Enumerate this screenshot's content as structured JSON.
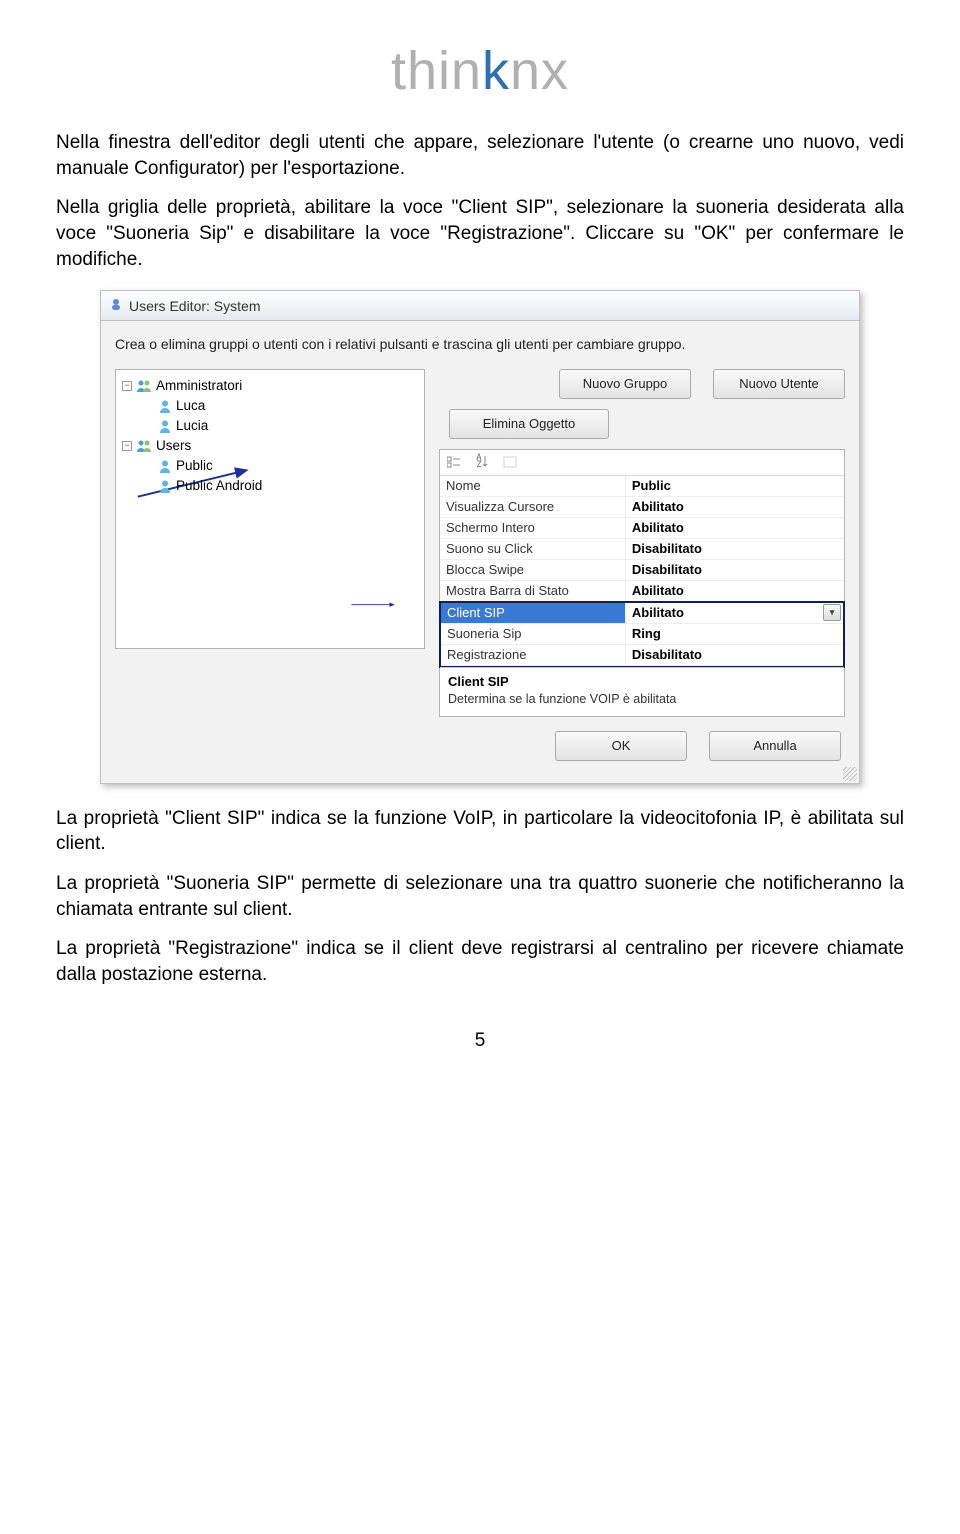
{
  "logo": {
    "part1": "thin",
    "part2": "k",
    "part3": "nx"
  },
  "paragraphs": {
    "p1": "Nella finestra dell'editor degli utenti che appare, selezionare l'utente (o crearne uno nuovo, vedi manuale Configurator) per l'esportazione.",
    "p2": "Nella griglia delle proprietà, abilitare la voce \"Client SIP\", selezionare la suoneria desiderata alla voce \"Suoneria Sip\" e disabilitare la voce \"Registrazione\". Cliccare su \"OK\" per confermare le modifiche.",
    "p3": "La proprietà \"Client SIP\" indica se la funzione VoIP, in particolare la videocitofonia IP, è abilitata sul client.",
    "p4": "La proprietà \"Suoneria SIP\" permette di selezionare una tra quattro suonerie che notificheranno la chiamata entrante sul client.",
    "p5": "La proprietà \"Registrazione\" indica se il client deve registrarsi al centralino per ricevere chiamate dalla postazione esterna."
  },
  "dialog": {
    "title": "Users Editor: System",
    "hint": "Crea o elimina gruppi o utenti con i relativi pulsanti e trascina gli utenti per cambiare gruppo.",
    "buttons": {
      "newGroup": "Nuovo Gruppo",
      "newUser": "Nuovo Utente",
      "delete": "Elimina Oggetto",
      "ok": "OK",
      "cancel": "Annulla"
    },
    "tree": [
      {
        "type": "group",
        "label": "Amministratori",
        "level": 0
      },
      {
        "type": "user",
        "label": "Luca",
        "level": 1
      },
      {
        "type": "user",
        "label": "Lucia",
        "level": 1
      },
      {
        "type": "group",
        "label": "Users",
        "level": 0
      },
      {
        "type": "user",
        "label": "Public",
        "level": 1
      },
      {
        "type": "user",
        "label": "Public Android",
        "level": 1
      }
    ],
    "propGrid": {
      "toolbarAZ": "A Z",
      "rows": [
        {
          "name": "Nome",
          "value": "Public"
        },
        {
          "name": "Visualizza Cursore",
          "value": "Abilitato"
        },
        {
          "name": "Schermo Intero",
          "value": "Abilitato"
        },
        {
          "name": "Suono su Click",
          "value": "Disabilitato"
        },
        {
          "name": "Blocca Swipe",
          "value": "Disabilitato"
        },
        {
          "name": "Mostra Barra di Stato",
          "value": "Abilitato"
        },
        {
          "name": "Client SIP",
          "value": "Abilitato",
          "selected": true,
          "dropdown": true
        },
        {
          "name": "Suoneria Sip",
          "value": "Ring"
        },
        {
          "name": "Registrazione",
          "value": "Disabilitato"
        }
      ],
      "descTitle": "Client SIP",
      "descText": "Determina se la funzione VOIP è abilitata"
    }
  },
  "pageNumber": "5"
}
